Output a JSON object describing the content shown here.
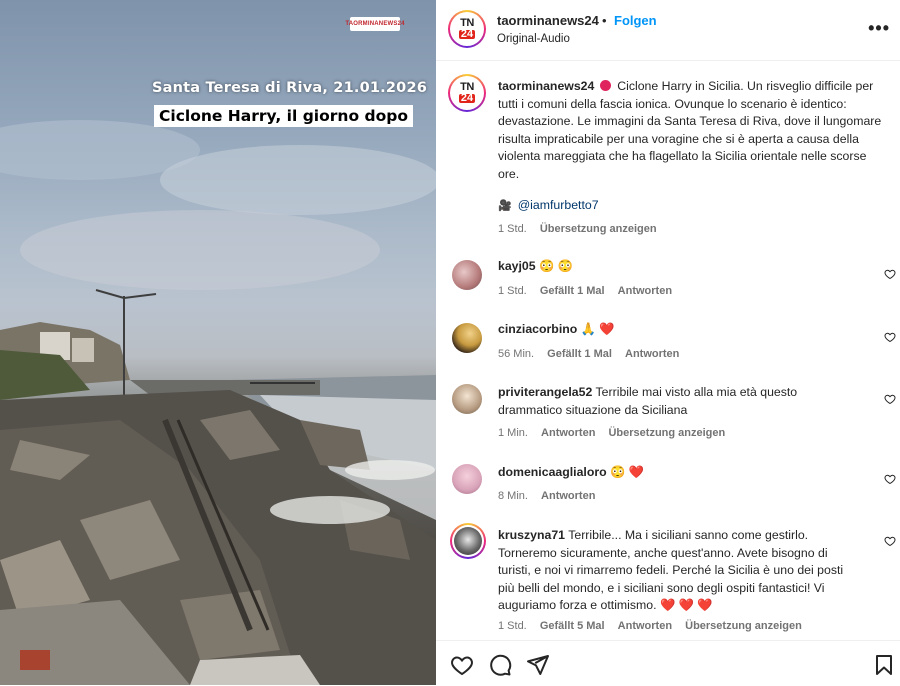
{
  "media": {
    "watermark": "TAORMINANEWS24",
    "caption_line1": "Santa Teresa di Riva, 21.01.2026",
    "caption_line2": "Ciclone Harry, il giorno dopo"
  },
  "header": {
    "username": "taorminanews24",
    "separator": "•",
    "follow_label": "Folgen",
    "audio_label": "Original-Audio",
    "more_label": "•••"
  },
  "post": {
    "username": "taorminanews24",
    "text": "Ciclone Harry in Sicilia. Un risveglio difficile per tutti i comuni della fascia ionica. Ovunque lo scenario è identico: devastazione. Le immagini da Santa Teresa di Riva, dove il lungomare risulta impraticabile per una voragine che si è aperta a causa della violenta mareggiata che ha flagellato la Sicilia orientale nelle scorse ore.",
    "tag_icon": "🎥",
    "tag": "@iamfurbetto7",
    "time": "1 Std.",
    "translate_label": "Übersetzung anzeigen"
  },
  "comments": [
    {
      "username": "kayj05",
      "text": "😳 😳",
      "time": "1 Std.",
      "likes": "Gefällt 1 Mal",
      "reply": "Antworten",
      "translate": ""
    },
    {
      "username": "cinziacorbino",
      "text": "🙏 ❤️",
      "time": "56 Min.",
      "likes": "Gefällt 1 Mal",
      "reply": "Antworten",
      "translate": ""
    },
    {
      "username": "priviterangela52",
      "text": "Terribile mai visto alla mia età questo drammatico situazione da Siciliana",
      "time": "1 Min.",
      "likes": "",
      "reply": "Antworten",
      "translate": "Übersetzung anzeigen"
    },
    {
      "username": "domenicaaglialoro",
      "text": "😳 ❤️",
      "time": "8 Min.",
      "likes": "",
      "reply": "Antworten",
      "translate": ""
    },
    {
      "username": "kruszyna71",
      "text": "Terribile... Ma i siciliani sanno come gestirlo. Torneremo sicuramente, anche quest'anno. Avete bisogno di turisti, e noi vi rimarremo fedeli. Perché la Sicilia è uno dei posti più belli del mondo, e i siciliani sono degli ospiti fantastici! Vi auguriamo forza e ottimismo. ❤️ ❤️ ❤️",
      "time": "1 Std.",
      "likes": "Gefällt 5 Mal",
      "reply": "Antworten",
      "translate": "Übersetzung anzeigen"
    }
  ],
  "avatar_text": {
    "tn": "TN",
    "num": "24"
  },
  "colors": {
    "accent": "#0095f6",
    "text": "#262626",
    "muted": "#737373",
    "brand_red": "#e1251b"
  }
}
